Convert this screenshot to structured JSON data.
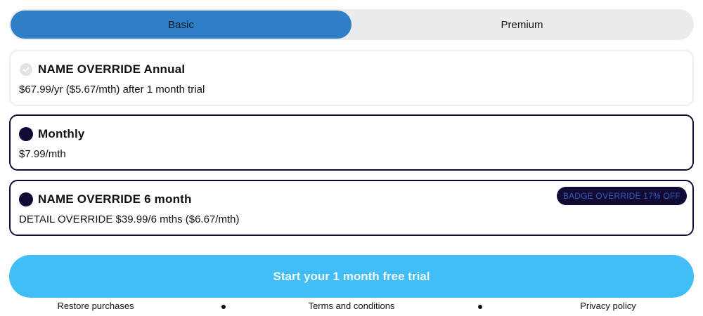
{
  "tabs": [
    {
      "label": "Basic",
      "active": true
    },
    {
      "label": "Premium",
      "active": false
    }
  ],
  "plans": [
    {
      "name": "NAME OVERRIDE Annual",
      "detail": "$67.99/yr ($5.67/mth) after 1 month trial",
      "state": "disabled",
      "icon": "check-circle-icon"
    },
    {
      "name": "Monthly",
      "detail": "$7.99/mth",
      "state": "selectable",
      "icon": "radio-icon"
    },
    {
      "name": "NAME OVERRIDE 6 month",
      "detail": "DETAIL OVERRIDE $39.99/6 mths ($6.67/mth)",
      "state": "selectable",
      "icon": "radio-icon",
      "badge": "BADGE OVERRIDE 17% OFF"
    }
  ],
  "cta": {
    "label": "Start your 1 month free trial"
  },
  "footer": {
    "restore_label": "Restore purchases",
    "terms_label": "Terms and conditions",
    "privacy_label": "Privacy policy"
  },
  "colors": {
    "active_tab": "#2f7fc6",
    "tab_track": "#ececee",
    "plan_border": "#120a35",
    "cta": "#40bef5"
  }
}
